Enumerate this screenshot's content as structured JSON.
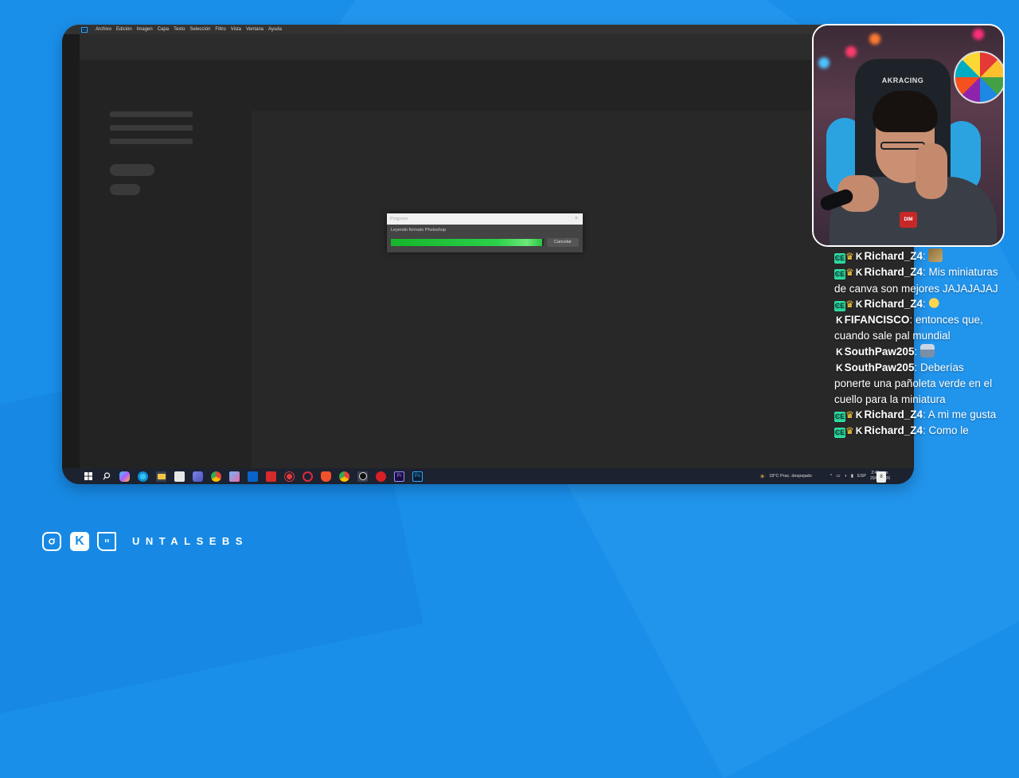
{
  "photoshop": {
    "app_icon": "Ps",
    "menu": [
      "Archivo",
      "Edición",
      "Imagen",
      "Capa",
      "Texto",
      "Selección",
      "Filtro",
      "Vista",
      "Ventana",
      "Ayuda"
    ]
  },
  "dialog": {
    "title": "Progreso",
    "close": "×",
    "message": "Leyendo formato Photoshop",
    "progress_fraction": 0.99,
    "cancel_label": "Cancelar"
  },
  "taskbar": {
    "weather": "18°C  Prac. despejado",
    "language": "ESP",
    "time": "2:48 a. m.",
    "date": "20/04/2026",
    "notifications": "8",
    "icons": [
      "windows-start-icon",
      "search-icon",
      "copilot-icon",
      "edge-icon",
      "file-explorer-icon",
      "store-icon",
      "teams-icon",
      "chrome-icon",
      "photos-icon",
      "outlook-icon",
      "news-icon",
      "davinci-icon",
      "opera-icon",
      "brave-icon",
      "chrome-alt-icon",
      "obs-icon",
      "creative-cloud-icon",
      "premiere-icon",
      "photoshop-icon"
    ]
  },
  "webcam": {
    "chair_brand": "AKRACING",
    "shirt_badge": "DIM"
  },
  "chat": [
    {
      "user": "Richard_Z4",
      "badges": [
        "sub",
        "crown",
        "kick"
      ],
      "text": "",
      "emote": "photo"
    },
    {
      "user": "Richard_Z4",
      "badges": [
        "sub",
        "crown",
        "kick"
      ],
      "text": "Mis miniaturas de canva son mejores JAJAJAJAJ",
      "emote": ""
    },
    {
      "user": "Richard_Z4",
      "badges": [
        "sub",
        "crown",
        "kick"
      ],
      "text": "",
      "emote": "fish"
    },
    {
      "user": "FIFANCISCO",
      "badges": [
        "kick"
      ],
      "text": "entonces que, cuando sale pal mundial",
      "emote": ""
    },
    {
      "user": "SouthPaw205",
      "badges": [
        "kick"
      ],
      "text": "",
      "emote": "man"
    },
    {
      "user": "SouthPaw205",
      "badges": [
        "kick"
      ],
      "text": "Deberías ponerte una pañoleta verde en el cuello para la miniatura",
      "emote": ""
    },
    {
      "user": "Richard_Z4",
      "badges": [
        "sub",
        "crown",
        "kick"
      ],
      "text": "A mi me gusta",
      "emote": ""
    },
    {
      "user": "Richard_Z4",
      "badges": [
        "sub",
        "crown",
        "kick"
      ],
      "text": "Como le",
      "emote": ""
    }
  ],
  "footer": {
    "handle": "UNTALSEBS",
    "icons": [
      "instagram-icon",
      "kick-icon",
      "twitch-icon"
    ]
  }
}
